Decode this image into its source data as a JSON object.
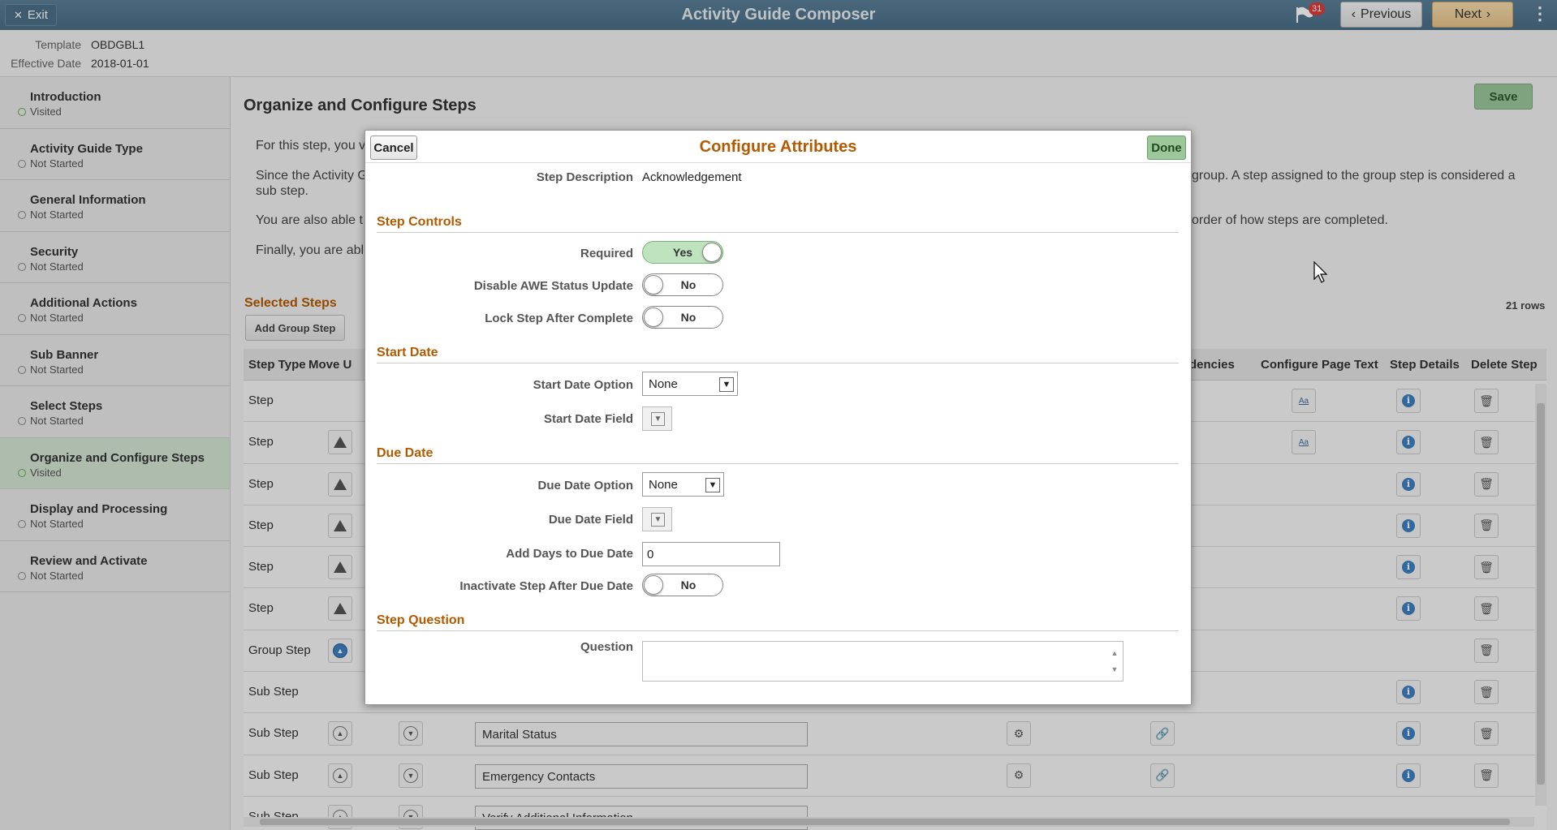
{
  "header": {
    "exit_label": "Exit",
    "title": "Activity Guide Composer",
    "notification_count": "31",
    "previous_label": "Previous",
    "next_label": "Next"
  },
  "template_info": {
    "template_label": "Template",
    "template_value": "OBDGBL1",
    "effective_date_label": "Effective Date",
    "effective_date_value": "2018-01-01"
  },
  "sidebar": {
    "items": [
      {
        "title": "Introduction",
        "status": "Visited"
      },
      {
        "title": "Activity Guide Type",
        "status": "Not Started"
      },
      {
        "title": "General Information",
        "status": "Not Started"
      },
      {
        "title": "Security",
        "status": "Not Started"
      },
      {
        "title": "Additional Actions",
        "status": "Not Started"
      },
      {
        "title": "Sub Banner",
        "status": "Not Started"
      },
      {
        "title": "Select Steps",
        "status": "Not Started"
      },
      {
        "title": "Organize and Configure Steps",
        "status": "Visited"
      },
      {
        "title": "Display and Processing",
        "status": "Not Started"
      },
      {
        "title": "Review and Activate",
        "status": "Not Started"
      }
    ]
  },
  "main": {
    "title": "Organize and Configure Steps",
    "save_label": "Save",
    "para1": "For this step, you v",
    "para2a": "Since the Activity G",
    "para2b": "group. A step assigned to the group step is considered a",
    "para2c": "sub step.",
    "para3a": "You are also able t",
    "para3b": "order of how steps are completed.",
    "para4": "Finally, you are abl",
    "selected_steps_label": "Selected Steps",
    "rows_count": "21 rows",
    "add_group_step_label": "Add Group Step",
    "columns": {
      "step_type": "Step Type",
      "move_up": "Move U",
      "dependencies": "dencies",
      "configure_page_text": "Configure Page Text",
      "step_details": "Step Details",
      "delete_step": "Delete Step"
    },
    "rows": [
      {
        "type": "Step",
        "name": ""
      },
      {
        "type": "Step",
        "name": ""
      },
      {
        "type": "Step",
        "name": ""
      },
      {
        "type": "Step",
        "name": ""
      },
      {
        "type": "Step",
        "name": ""
      },
      {
        "type": "Step",
        "name": ""
      },
      {
        "type": "Group Step",
        "name": ""
      },
      {
        "type": "Sub Step",
        "name": ""
      },
      {
        "type": "Sub Step",
        "name": "Marital Status"
      },
      {
        "type": "Sub Step",
        "name": "Emergency Contacts"
      },
      {
        "type": "Sub Step",
        "name": "Verify Additional Information"
      }
    ]
  },
  "modal": {
    "title": "Configure Attributes",
    "cancel_label": "Cancel",
    "done_label": "Done",
    "step_description_label": "Step Description",
    "step_description_value": "Acknowledgement",
    "step_controls_heading": "Step Controls",
    "required_label": "Required",
    "required_value": "Yes",
    "disable_awe_label": "Disable AWE Status Update",
    "disable_awe_value": "No",
    "lock_step_label": "Lock Step After Complete",
    "lock_step_value": "No",
    "start_date_heading": "Start Date",
    "start_date_option_label": "Start Date Option",
    "start_date_option_value": "None",
    "start_date_field_label": "Start Date Field",
    "due_date_heading": "Due Date",
    "due_date_option_label": "Due Date Option",
    "due_date_option_value": "None",
    "due_date_field_label": "Due Date Field",
    "add_days_label": "Add Days to Due Date",
    "add_days_value": "0",
    "inactivate_label": "Inactivate Step After Due Date",
    "inactivate_value": "No",
    "step_question_heading": "Step Question",
    "question_label": "Question",
    "question_value": ""
  },
  "colors": {
    "header_bg": "#4a6e87",
    "accent_orange": "#b35a00",
    "save_green": "#9cc79a",
    "active_nav": "#d5e6d5"
  }
}
